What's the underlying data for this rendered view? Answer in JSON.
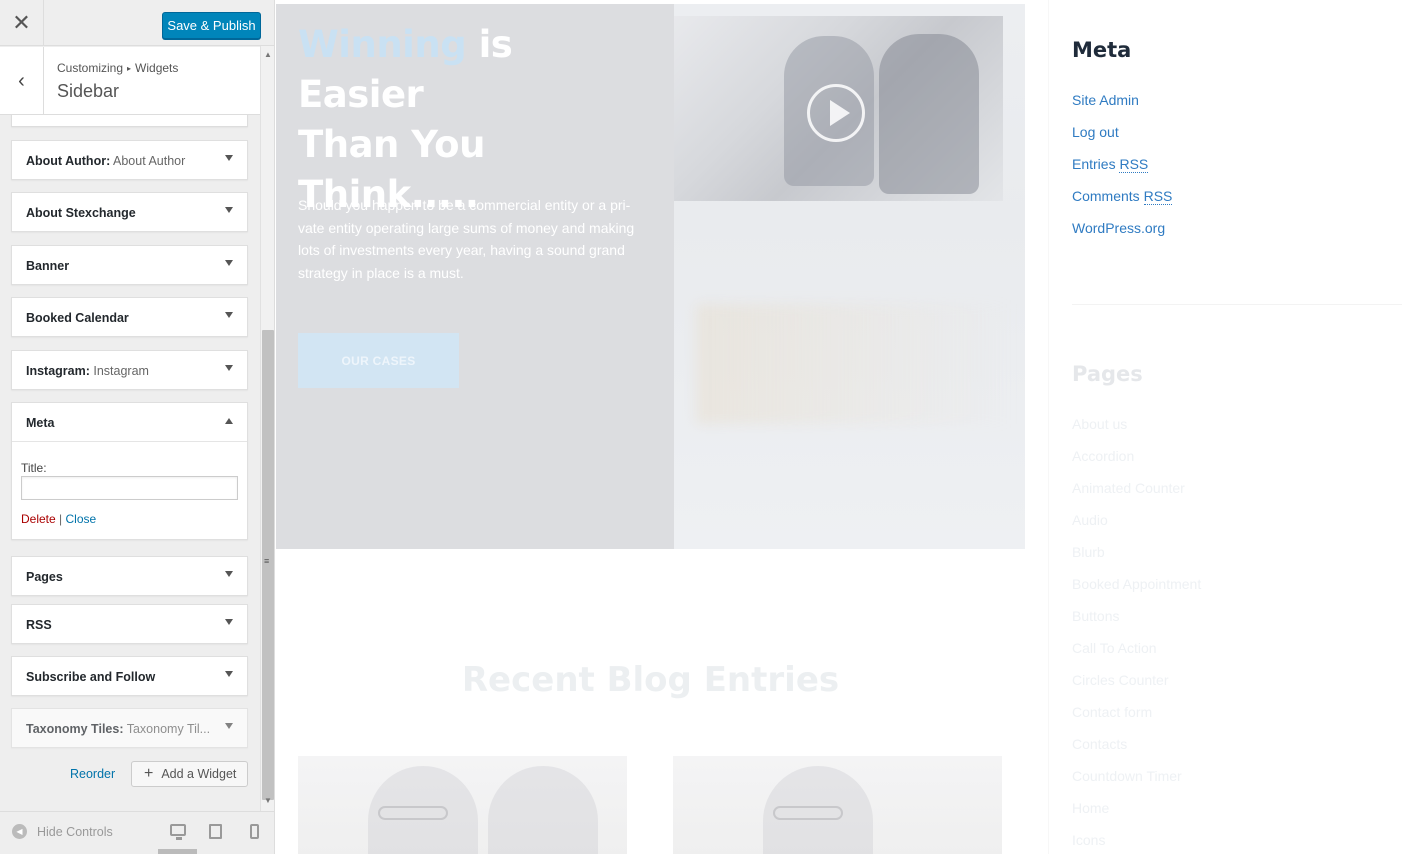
{
  "customizer": {
    "close_icon": "close-icon",
    "publish_label": "Save & Publish",
    "breadcrumb": {
      "parent": "Customizing",
      "separator": "▸",
      "current": "Widgets"
    },
    "section_title": "Sidebar",
    "widgets_before": [
      {
        "title": "About Author:",
        "subtitle": " About Author"
      },
      {
        "title": "About Stexchange",
        "subtitle": ""
      },
      {
        "title": "Banner",
        "subtitle": ""
      },
      {
        "title": "Booked Calendar",
        "subtitle": ""
      },
      {
        "title": "Instagram:",
        "subtitle": " Instagram"
      }
    ],
    "open_widget": {
      "title": "Meta",
      "field_label": "Title:",
      "field_value": "",
      "delete_label": "Delete",
      "separator": " | ",
      "close_label": "Close"
    },
    "widgets_after": [
      {
        "title": "Pages",
        "subtitle": ""
      },
      {
        "title": "RSS",
        "subtitle": ""
      },
      {
        "title": "Subscribe and Follow",
        "subtitle": ""
      },
      {
        "title": "Taxonomy Tiles:",
        "subtitle": " Taxonomy Til..."
      }
    ],
    "reorder_label": "Reorder",
    "add_widget_label": "Add a Widget",
    "hide_controls_label": "Hide Controls",
    "devices": [
      "desktop",
      "tablet",
      "mobile"
    ]
  },
  "preview": {
    "hero": {
      "title_highlight": "Winning",
      "title_rest_1": " is Easier",
      "title_line_2": "Than You",
      "title_line_3": "Think.....",
      "text": "Should you happen to be a commercial entity or a pri-vate entity operating large sums of money and making lots of investments every year, having a sound grand strategy in place is a must.",
      "button_label": "OUR CASES"
    },
    "recent_title": "Recent Blog Entries",
    "sidebar": {
      "meta_title": "Meta",
      "meta_links": [
        {
          "text": "Site Admin",
          "abbr": ""
        },
        {
          "text": "Log out",
          "abbr": ""
        },
        {
          "text": "Entries ",
          "abbr": "RSS"
        },
        {
          "text": "Comments ",
          "abbr": "RSS"
        },
        {
          "text": "WordPress.org",
          "abbr": ""
        }
      ],
      "pages_title": "Pages",
      "pages_links": [
        "About us",
        "Accordion",
        "Animated Counter",
        "Audio",
        "Blurb",
        "Booked Appointment",
        "Buttons",
        "Call To Action",
        "Circles Counter",
        "Contact form",
        "Contacts",
        "Countdown Timer",
        "Home",
        "Icons"
      ]
    }
  },
  "colors": {
    "publish_bg": "#0085ba",
    "link": "#2f7bc2",
    "delete": "#aa0000",
    "hero_highlight": "#c9e1f3"
  }
}
